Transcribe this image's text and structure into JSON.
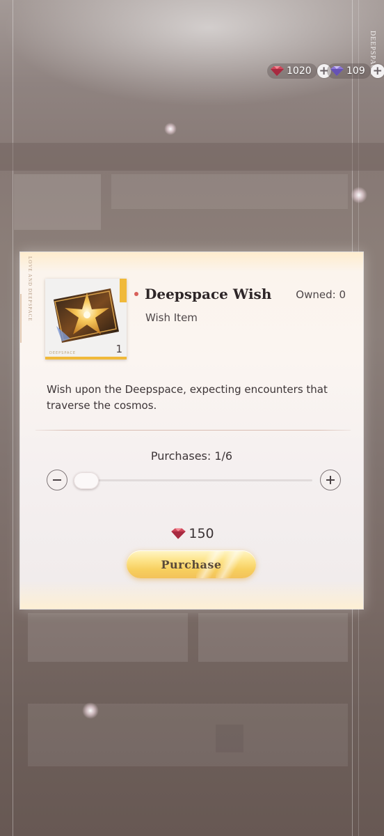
{
  "currency": {
    "primary": {
      "icon": "red-gem-icon",
      "value": "1020"
    },
    "secondary": {
      "icon": "purple-gem-icon",
      "value": "109"
    }
  },
  "brand_vertical": "DEEPSPACE",
  "dialog": {
    "side_text": "LOVE AND DEEPSPACE",
    "item": {
      "name": "Deepspace Wish",
      "type": "Wish Item",
      "owned": "Owned: 0",
      "quantity": "1",
      "card_tag": "DEEPSPACE",
      "icon": "star-ticket-icon"
    },
    "description": "Wish upon the Deepspace, expecting encounters that traverse the cosmos.",
    "purchases": {
      "label": "Purchases: 1/6",
      "current": 1,
      "max": 6
    },
    "price": {
      "icon": "red-gem-icon",
      "amount": "150"
    },
    "purchase_button": "Purchase"
  },
  "colors": {
    "accent_gold": "#f3c25a",
    "name_dot": "#d8605a",
    "text_dark": "#2e2628"
  }
}
